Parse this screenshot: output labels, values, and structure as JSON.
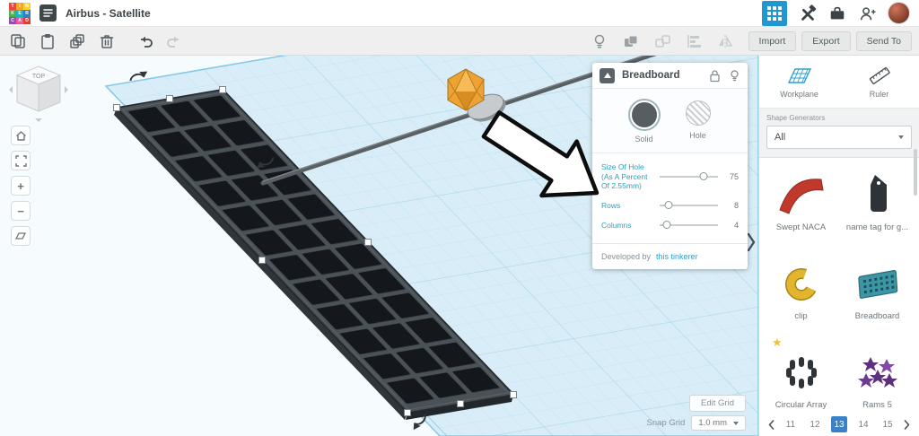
{
  "topbar": {
    "logo_letters": [
      "T",
      "I",
      "N",
      "K",
      "E",
      "R",
      "C",
      "A",
      "D"
    ],
    "logo_colors": [
      "#e8483f",
      "#f5a623",
      "#f8d12f",
      "#4cb04f",
      "#18b3c4",
      "#2f80c3",
      "#8f4fb5",
      "#e85a9b",
      "#d93f33"
    ],
    "title": "Airbus - Satellite"
  },
  "toolbar": {
    "import_label": "Import",
    "export_label": "Export",
    "send_to_label": "Send To"
  },
  "inspector": {
    "title": "Breadboard",
    "solid_label": "Solid",
    "hole_label": "Hole",
    "params": [
      {
        "label": "Size Of Hole (As A Percent Of 2.55mm)",
        "value": "75",
        "handle_pct": 76
      },
      {
        "label": "Rows",
        "value": "8",
        "handle_pct": 15
      },
      {
        "label": "Columns",
        "value": "4",
        "handle_pct": 13
      }
    ],
    "developed_by_label": "Developed by",
    "developer_link": "this tinkerer"
  },
  "canvas": {
    "viewcube_top_label": "TOP",
    "edit_grid_label": "Edit Grid",
    "snap_grid_label": "Snap Grid",
    "snap_grid_value": "1.0 mm"
  },
  "sidebar": {
    "workplane_label": "Workplane",
    "ruler_label": "Ruler",
    "shape_generators_label": "Shape Generators",
    "shape_generators_value": "All",
    "shapes": [
      {
        "name": "Swept NACA"
      },
      {
        "name": "name tag for g..."
      },
      {
        "name": "clip"
      },
      {
        "name": "Breadboard"
      },
      {
        "name": "Circular Array"
      },
      {
        "name": "Rams 5"
      }
    ],
    "pagination": {
      "pages": [
        "11",
        "12",
        "13",
        "14",
        "15"
      ],
      "current": "13"
    }
  },
  "colors": {
    "accent_blue": "#2196d3",
    "selected_page_blue": "#3c80c8",
    "plane_blue": "#d8edf7",
    "param_label_teal": "#2d9db8"
  }
}
